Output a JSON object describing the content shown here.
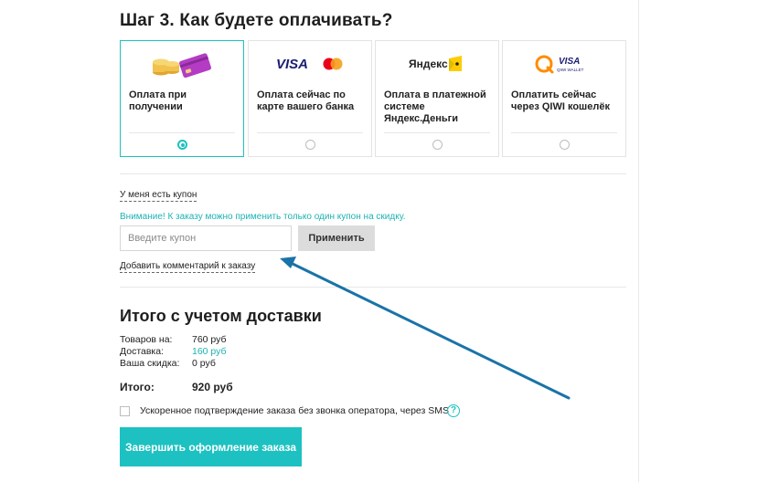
{
  "step": {
    "title": "Шаг 3. Как будете оплачивать?"
  },
  "payment_options": [
    {
      "label": "Оплата при получении",
      "selected": true,
      "icon": "coins-and-card-icon"
    },
    {
      "label": "Оплата сейчас по карте вашего банка",
      "selected": false,
      "icon": "visa-mastercard-icon",
      "logo_text": "VISA"
    },
    {
      "label": "Оплата в платежной системе Яндекс.Деньги",
      "selected": false,
      "icon": "yandex-money-icon",
      "logo_text": "Яндекс"
    },
    {
      "label": "Оплатить сейчас через QIWI кошелёк",
      "selected": false,
      "icon": "qiwi-icon",
      "logo_text": "VISA",
      "logo_subtext": "QIWI WALLET"
    }
  ],
  "coupon": {
    "toggle_label": "У меня есть купон",
    "notice": "Внимание! К заказу можно применить только один купон на скидку.",
    "placeholder": "Введите купон",
    "apply_label": "Применить"
  },
  "comment": {
    "toggle_label": "Добавить комментарий к заказу"
  },
  "summary": {
    "title": "Итого с учетом доставки",
    "goods_label": "Товаров на:",
    "goods_value": "760 руб",
    "delivery_label": "Доставка:",
    "delivery_value": "160 руб",
    "discount_label": "Ваша скидка:",
    "discount_value": "0 руб",
    "total_label": "Итого:",
    "total_value": "920 руб"
  },
  "sms": {
    "label": "Ускоренное подтверждение заказа без звонка оператора, через SMS",
    "checked": false,
    "help_glyph": "?"
  },
  "submit": {
    "label": "Завершить оформление заказа"
  },
  "colors": {
    "accent": "#1dc1c1",
    "arrow": "#1a73a8"
  }
}
